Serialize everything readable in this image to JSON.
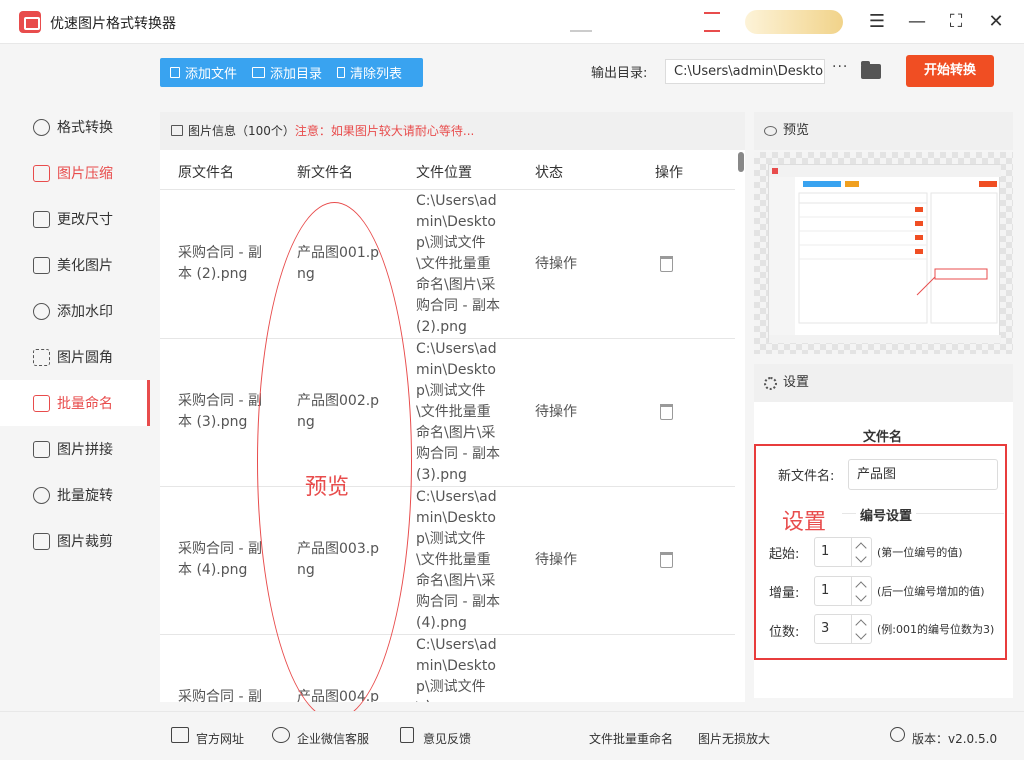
{
  "window": {
    "title": "优速图片格式转换器",
    "menu_icon": "☰",
    "minimize_icon": "—",
    "maximize_icon": "⛶",
    "close_icon": "✕"
  },
  "sidebar": {
    "items": [
      {
        "label": "格式转换",
        "icon": "format-convert-icon"
      },
      {
        "label": "图片压缩",
        "icon": "compress-icon"
      },
      {
        "label": "更改尺寸",
        "icon": "resize-icon"
      },
      {
        "label": "美化图片",
        "icon": "beautify-icon"
      },
      {
        "label": "添加水印",
        "icon": "watermark-icon"
      },
      {
        "label": "图片圆角",
        "icon": "round-corner-icon"
      },
      {
        "label": "批量命名",
        "icon": "rename-icon",
        "active": true
      },
      {
        "label": "图片拼接",
        "icon": "stitch-icon"
      },
      {
        "label": "批量旋转",
        "icon": "rotate-icon"
      },
      {
        "label": "图片裁剪",
        "icon": "crop-icon"
      }
    ]
  },
  "toolbar": {
    "add_file": "添加文件",
    "add_folder": "添加目录",
    "clear_list": "清除列表"
  },
  "output": {
    "label": "输出目录:",
    "path": "C:\\Users\\admin\\Deskto",
    "more": "···"
  },
  "start_button": "开始转换",
  "info_bar": {
    "title": "图片信息（100个）",
    "notice": "注意：如果图片较大请耐心等待..."
  },
  "table": {
    "headers": [
      "原文件名",
      "新文件名",
      "文件位置",
      "状态",
      "操作"
    ],
    "rows": [
      {
        "orig": "采购合同 - 副本 (2).png",
        "new": "产品图001.png",
        "path": "C:\\Users\\admin\\Desktop\\测试文件\\文件批量重命名\\图片\\采购合同 - 副本(2).png",
        "status": "待操作"
      },
      {
        "orig": "采购合同 - 副本 (3).png",
        "new": "产品图002.png",
        "path": "C:\\Users\\admin\\Desktop\\测试文件\\文件批量重命名\\图片\\采购合同 - 副本(3).png",
        "status": "待操作"
      },
      {
        "orig": "采购合同 - 副本 (4).png",
        "new": "产品图003.png",
        "path": "C:\\Users\\admin\\Desktop\\测试文件\\文件批量重命名\\图片\\采购合同 - 副本(4).png",
        "status": "待操作"
      },
      {
        "orig": "采购合同 - 副",
        "new": "产品图004.p",
        "path": "C:\\Users\\admin\\Desktop\\测试文件\\文",
        "status": ""
      }
    ]
  },
  "preview": {
    "title": "预览"
  },
  "settings": {
    "title": "设置",
    "section_filename": "文件名",
    "new_name_label": "新文件名:",
    "new_name_value": "产品图",
    "section_numbering": "编号设置",
    "start_label": "起始:",
    "start_value": "1",
    "start_hint": "(第一位编号的值)",
    "step_label": "增量:",
    "step_value": "1",
    "step_hint": "(后一位编号增加的值)",
    "digits_label": "位数:",
    "digits_value": "3",
    "digits_hint": "(例:001的编号位数为3)"
  },
  "annotations": {
    "preview_label": "预览",
    "settings_label": "设置"
  },
  "footer": {
    "website": "官方网址",
    "wechat": "企业微信客服",
    "feedback": "意见反馈",
    "link1": "文件批量重命名",
    "link2": "图片无损放大",
    "version": "版本：v2.0.5.0"
  },
  "colors": {
    "accent": "#e84c4c",
    "toolbar_blue": "#39a3f0",
    "start_button": "#f04e23"
  }
}
